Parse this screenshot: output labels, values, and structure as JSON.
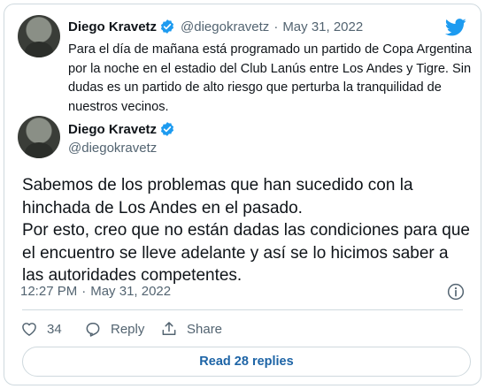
{
  "quoted": {
    "name": "Diego Kravetz",
    "handle": "@diegokravetz",
    "separator": "·",
    "date": "May 31, 2022",
    "text": "Para el día de mañana está programado un partido de Copa Argentina por la noche en el estadio del Club Lanús entre Los Andes y Tigre. Sin dudas es un partido de alto riesgo que perturba la tranquilidad de nuestros vecinos."
  },
  "tweet": {
    "name": "Diego Kravetz",
    "handle": "@diegokravetz",
    "text": "Sabemos de los problemas que han sucedido con la hinchada de Los Andes en el pasado.\nPor esto, creo que no están dadas las condiciones para que el encuentro se lleve adelante y así se lo hicimos saber a las autoridades competentes.",
    "time": "12:27 PM",
    "separator": "·",
    "date": "May 31, 2022"
  },
  "actions": {
    "like_count": "34",
    "reply_label": "Reply",
    "share_label": "Share"
  },
  "read_replies_label": "Read 28 replies",
  "colors": {
    "twitter_blue": "#1d9bf0",
    "link_blue": "#1d64a6",
    "muted": "#536471",
    "border": "#cfd9de"
  },
  "icons": [
    "twitter-bird-icon",
    "verified-badge-icon",
    "info-icon",
    "heart-icon",
    "reply-icon",
    "share-icon"
  ]
}
